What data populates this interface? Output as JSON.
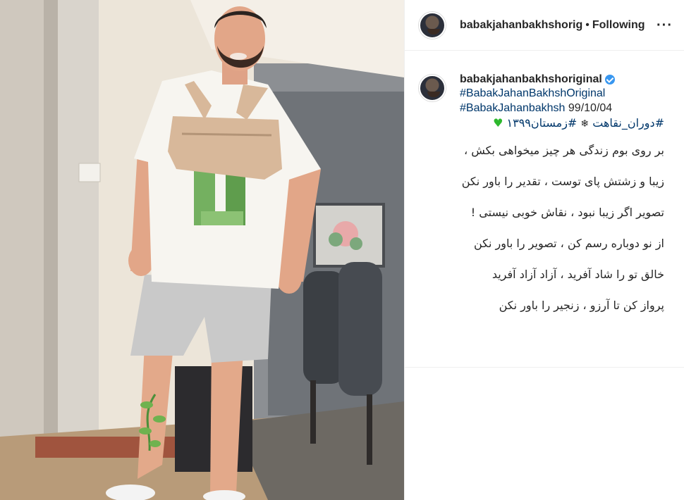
{
  "header": {
    "username": "babakjahanbakhshorig",
    "separator": "•",
    "follow_status": "Following",
    "more_label": "···"
  },
  "caption": {
    "username": "babakjahanbakhshoriginal",
    "hashtag_1": "#BabakJahanBakhshOriginal",
    "hashtag_2": "#BabakJahanbakhsh",
    "date": "99/10/04",
    "hashtag_3": "#دوران_نقاهت",
    "hashtag_4": "#زمستان۱۳۹۹",
    "poem": [
      "بر روی بوم زندگی هر چیز میخواهی بکش ،",
      "زیبا و زشتش پای توست ، تقدیر را باور نکن",
      "تصویر اگر زیبا نبود ، نقاش خوبی نیستی !",
      "از نو دوباره رسم کن ، تصویر را باور نکن",
      "خالق تو را شاد آفرید ، آزاد آزاد آفرید",
      "پرواز کن تا آرزو ، زنجیر را باور نکن"
    ]
  },
  "icons": {
    "verified": "verified-badge-icon",
    "heart": "green-heart-icon",
    "snowflake": "snowflake-icon",
    "more": "more-options-icon"
  },
  "colors": {
    "hashtag": "#00376b",
    "verified": "#3897f0",
    "heart": "#2db82d"
  }
}
